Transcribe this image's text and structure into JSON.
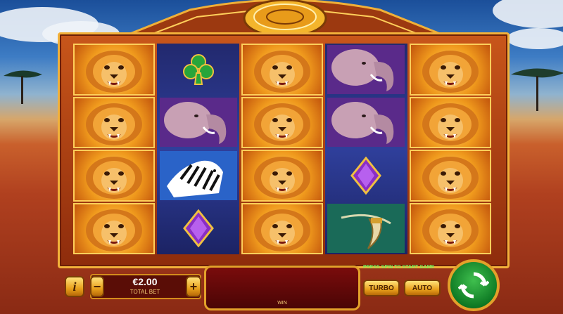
{
  "reels": [
    {
      "style": "gold",
      "symbols": [
        "lion",
        "lion",
        "lion",
        "lion"
      ]
    },
    {
      "style": "blue",
      "symbols": [
        "club",
        "elephant",
        "zebra",
        "diamond"
      ]
    },
    {
      "style": "gold",
      "symbols": [
        "lion",
        "lion",
        "lion",
        "lion"
      ]
    },
    {
      "style": "blue",
      "symbols": [
        "elephant",
        "elephant",
        "diamond",
        "tusk"
      ]
    },
    {
      "style": "gold",
      "symbols": [
        "lion",
        "lion",
        "lion",
        "lion"
      ]
    }
  ],
  "controls": {
    "info_label": "i",
    "minus_label": "−",
    "plus_label": "+",
    "bet_value": "€2.00",
    "bet_caption": "TOTAL BET",
    "win_caption": "WIN",
    "prompt": "PRESS SPIN TO START GAME",
    "turbo_label": "TURBO",
    "auto_label": "AUTO"
  },
  "colors": {
    "prompt": "#7cf25a",
    "gold": "#e9a11c",
    "spin": "#0e7a24"
  }
}
